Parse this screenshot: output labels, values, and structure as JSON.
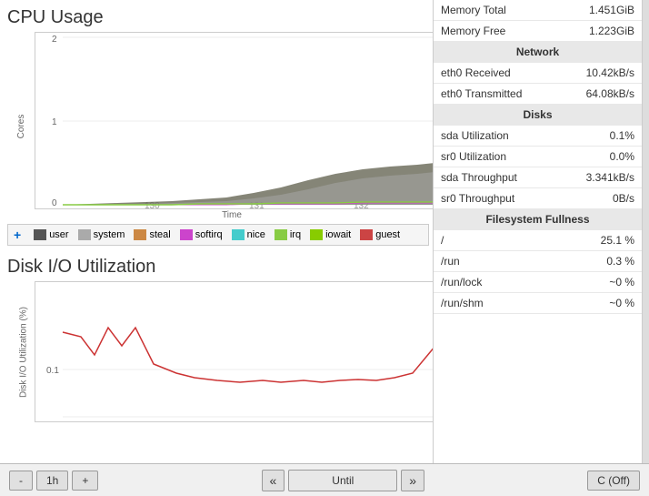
{
  "header": {
    "cpu_title": "CPU Usage",
    "disk_title": "Disk I/O Utilization"
  },
  "cpu_chart": {
    "y_label": "Cores",
    "x_label": "Time",
    "y_ticks": [
      "2",
      "1",
      "0"
    ],
    "x_ticks": [
      "130",
      "131",
      "132"
    ]
  },
  "disk_chart": {
    "y_label": "Disk I/O Utilization (%)",
    "y_tick": "0.1"
  },
  "legend": {
    "items": [
      {
        "label": "user",
        "color": "#555555"
      },
      {
        "label": "system",
        "color": "#aaaaaa"
      },
      {
        "label": "steal",
        "color": "#cc8844"
      },
      {
        "label": "softirq",
        "color": "#cc44cc"
      },
      {
        "label": "nice",
        "color": "#44cccc"
      },
      {
        "label": "irq",
        "color": "#88cc44"
      },
      {
        "label": "iowait",
        "color": "#88cc00"
      },
      {
        "label": "guest",
        "color": "#cc4444"
      }
    ]
  },
  "stats": {
    "memory": [
      {
        "label": "Memory Total",
        "value": "1.451GiB"
      },
      {
        "label": "Memory Free",
        "value": "1.223GiB"
      }
    ],
    "network_header": "Network",
    "network": [
      {
        "label": "eth0 Received",
        "value": "10.42kB/s"
      },
      {
        "label": "eth0 Transmitted",
        "value": "64.08kB/s"
      }
    ],
    "disks_header": "Disks",
    "disks": [
      {
        "label": "sda Utilization",
        "value": "0.1%"
      },
      {
        "label": "sr0 Utilization",
        "value": "0.0%"
      },
      {
        "label": "sda Throughput",
        "value": "3.341kB/s"
      },
      {
        "label": "sr0 Throughput",
        "value": "0B/s"
      }
    ],
    "filesystem_header": "Filesystem Fullness",
    "filesystem": [
      {
        "label": "/",
        "value": "25.1 %"
      },
      {
        "label": "/run",
        "value": "0.3 %"
      },
      {
        "label": "/run/lock",
        "value": "~0 %"
      },
      {
        "label": "/run/shm",
        "value": "~0 %"
      }
    ]
  },
  "toolbar": {
    "minus_label": "-",
    "period_label": "1h",
    "plus_label": "+",
    "rewind_label": "«",
    "until_label": "Until",
    "forward_label": "»",
    "refresh_label": "C (Off)"
  }
}
